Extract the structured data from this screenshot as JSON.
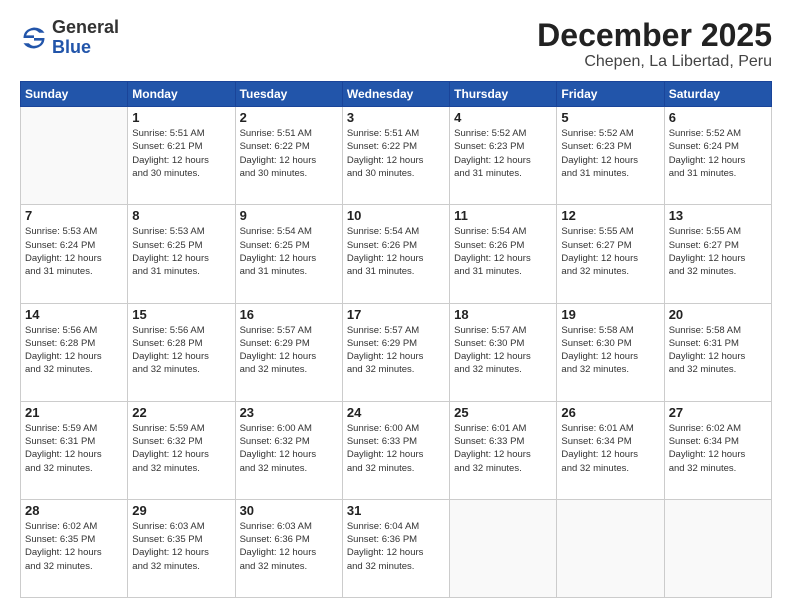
{
  "header": {
    "logo_general": "General",
    "logo_blue": "Blue",
    "title": "December 2025",
    "subtitle": "Chepen, La Libertad, Peru"
  },
  "calendar": {
    "days_of_week": [
      "Sunday",
      "Monday",
      "Tuesday",
      "Wednesday",
      "Thursday",
      "Friday",
      "Saturday"
    ],
    "weeks": [
      [
        {
          "day": "",
          "info": ""
        },
        {
          "day": "1",
          "info": "Sunrise: 5:51 AM\nSunset: 6:21 PM\nDaylight: 12 hours\nand 30 minutes."
        },
        {
          "day": "2",
          "info": "Sunrise: 5:51 AM\nSunset: 6:22 PM\nDaylight: 12 hours\nand 30 minutes."
        },
        {
          "day": "3",
          "info": "Sunrise: 5:51 AM\nSunset: 6:22 PM\nDaylight: 12 hours\nand 30 minutes."
        },
        {
          "day": "4",
          "info": "Sunrise: 5:52 AM\nSunset: 6:23 PM\nDaylight: 12 hours\nand 31 minutes."
        },
        {
          "day": "5",
          "info": "Sunrise: 5:52 AM\nSunset: 6:23 PM\nDaylight: 12 hours\nand 31 minutes."
        },
        {
          "day": "6",
          "info": "Sunrise: 5:52 AM\nSunset: 6:24 PM\nDaylight: 12 hours\nand 31 minutes."
        }
      ],
      [
        {
          "day": "7",
          "info": "Sunrise: 5:53 AM\nSunset: 6:24 PM\nDaylight: 12 hours\nand 31 minutes."
        },
        {
          "day": "8",
          "info": "Sunrise: 5:53 AM\nSunset: 6:25 PM\nDaylight: 12 hours\nand 31 minutes."
        },
        {
          "day": "9",
          "info": "Sunrise: 5:54 AM\nSunset: 6:25 PM\nDaylight: 12 hours\nand 31 minutes."
        },
        {
          "day": "10",
          "info": "Sunrise: 5:54 AM\nSunset: 6:26 PM\nDaylight: 12 hours\nand 31 minutes."
        },
        {
          "day": "11",
          "info": "Sunrise: 5:54 AM\nSunset: 6:26 PM\nDaylight: 12 hours\nand 31 minutes."
        },
        {
          "day": "12",
          "info": "Sunrise: 5:55 AM\nSunset: 6:27 PM\nDaylight: 12 hours\nand 32 minutes."
        },
        {
          "day": "13",
          "info": "Sunrise: 5:55 AM\nSunset: 6:27 PM\nDaylight: 12 hours\nand 32 minutes."
        }
      ],
      [
        {
          "day": "14",
          "info": "Sunrise: 5:56 AM\nSunset: 6:28 PM\nDaylight: 12 hours\nand 32 minutes."
        },
        {
          "day": "15",
          "info": "Sunrise: 5:56 AM\nSunset: 6:28 PM\nDaylight: 12 hours\nand 32 minutes."
        },
        {
          "day": "16",
          "info": "Sunrise: 5:57 AM\nSunset: 6:29 PM\nDaylight: 12 hours\nand 32 minutes."
        },
        {
          "day": "17",
          "info": "Sunrise: 5:57 AM\nSunset: 6:29 PM\nDaylight: 12 hours\nand 32 minutes."
        },
        {
          "day": "18",
          "info": "Sunrise: 5:57 AM\nSunset: 6:30 PM\nDaylight: 12 hours\nand 32 minutes."
        },
        {
          "day": "19",
          "info": "Sunrise: 5:58 AM\nSunset: 6:30 PM\nDaylight: 12 hours\nand 32 minutes."
        },
        {
          "day": "20",
          "info": "Sunrise: 5:58 AM\nSunset: 6:31 PM\nDaylight: 12 hours\nand 32 minutes."
        }
      ],
      [
        {
          "day": "21",
          "info": "Sunrise: 5:59 AM\nSunset: 6:31 PM\nDaylight: 12 hours\nand 32 minutes."
        },
        {
          "day": "22",
          "info": "Sunrise: 5:59 AM\nSunset: 6:32 PM\nDaylight: 12 hours\nand 32 minutes."
        },
        {
          "day": "23",
          "info": "Sunrise: 6:00 AM\nSunset: 6:32 PM\nDaylight: 12 hours\nand 32 minutes."
        },
        {
          "day": "24",
          "info": "Sunrise: 6:00 AM\nSunset: 6:33 PM\nDaylight: 12 hours\nand 32 minutes."
        },
        {
          "day": "25",
          "info": "Sunrise: 6:01 AM\nSunset: 6:33 PM\nDaylight: 12 hours\nand 32 minutes."
        },
        {
          "day": "26",
          "info": "Sunrise: 6:01 AM\nSunset: 6:34 PM\nDaylight: 12 hours\nand 32 minutes."
        },
        {
          "day": "27",
          "info": "Sunrise: 6:02 AM\nSunset: 6:34 PM\nDaylight: 12 hours\nand 32 minutes."
        }
      ],
      [
        {
          "day": "28",
          "info": "Sunrise: 6:02 AM\nSunset: 6:35 PM\nDaylight: 12 hours\nand 32 minutes."
        },
        {
          "day": "29",
          "info": "Sunrise: 6:03 AM\nSunset: 6:35 PM\nDaylight: 12 hours\nand 32 minutes."
        },
        {
          "day": "30",
          "info": "Sunrise: 6:03 AM\nSunset: 6:36 PM\nDaylight: 12 hours\nand 32 minutes."
        },
        {
          "day": "31",
          "info": "Sunrise: 6:04 AM\nSunset: 6:36 PM\nDaylight: 12 hours\nand 32 minutes."
        },
        {
          "day": "",
          "info": ""
        },
        {
          "day": "",
          "info": ""
        },
        {
          "day": "",
          "info": ""
        }
      ]
    ]
  }
}
